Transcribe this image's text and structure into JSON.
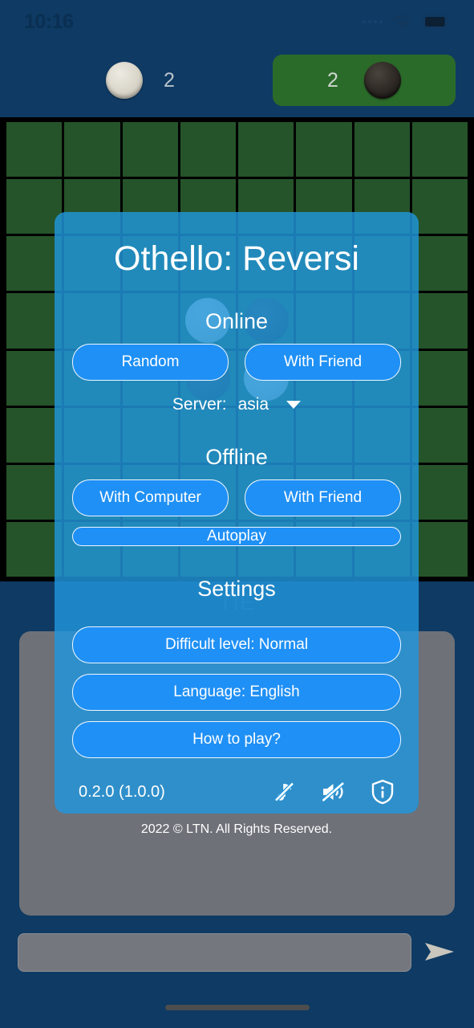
{
  "status_bar": {
    "time": "10:16",
    "signal_icon": "signal-dots-icon",
    "wifi_icon": "wifi-icon",
    "battery_icon": "battery-full-icon"
  },
  "score_bar": {
    "white": {
      "disc_icon": "white-disc-icon",
      "count": "2"
    },
    "black": {
      "disc_icon": "black-disc-icon",
      "count": "2",
      "active": true,
      "highlight_color": "#2b6b2a"
    }
  },
  "board": {
    "rows": 8,
    "cols": 8,
    "cell_color": "#25542a",
    "line_color": "#000000",
    "pieces": [
      {
        "row": 3,
        "col": 3,
        "color": "white"
      },
      {
        "row": 3,
        "col": 4,
        "color": "black"
      },
      {
        "row": 4,
        "col": 3,
        "color": "black"
      },
      {
        "row": 4,
        "col": 4,
        "color": "white"
      }
    ]
  },
  "background_text": "TIE",
  "dialog": {
    "title": "Othello: Reversi",
    "online": {
      "heading": "Online",
      "random_label": "Random",
      "with_friend_label": "With Friend",
      "server_label": "Server:",
      "server_value": "asia",
      "server_caret_icon": "chevron-down-icon"
    },
    "offline": {
      "heading": "Offline",
      "with_computer_label": "With Computer",
      "with_friend_label": "With Friend",
      "autoplay_label": "Autoplay"
    },
    "settings": {
      "heading": "Settings",
      "difficulty_label": "Difficult level: Normal",
      "language_label": "Language: English",
      "how_to_play_label": "How to play?"
    },
    "footer": {
      "version": "0.2.0 (1.0.0)",
      "music_off_icon": "music-note-off-icon",
      "sound_off_icon": "volume-off-icon",
      "info_icon": "info-shield-icon",
      "copyright": "2022 © LTN. All Rights Reserved."
    },
    "accent_color": "#1f90f5",
    "panel_color": "#2196dc"
  },
  "chat": {
    "panel_color": "#6e7178",
    "input_value": "",
    "input_placeholder": "",
    "send_icon": "send-icon"
  }
}
